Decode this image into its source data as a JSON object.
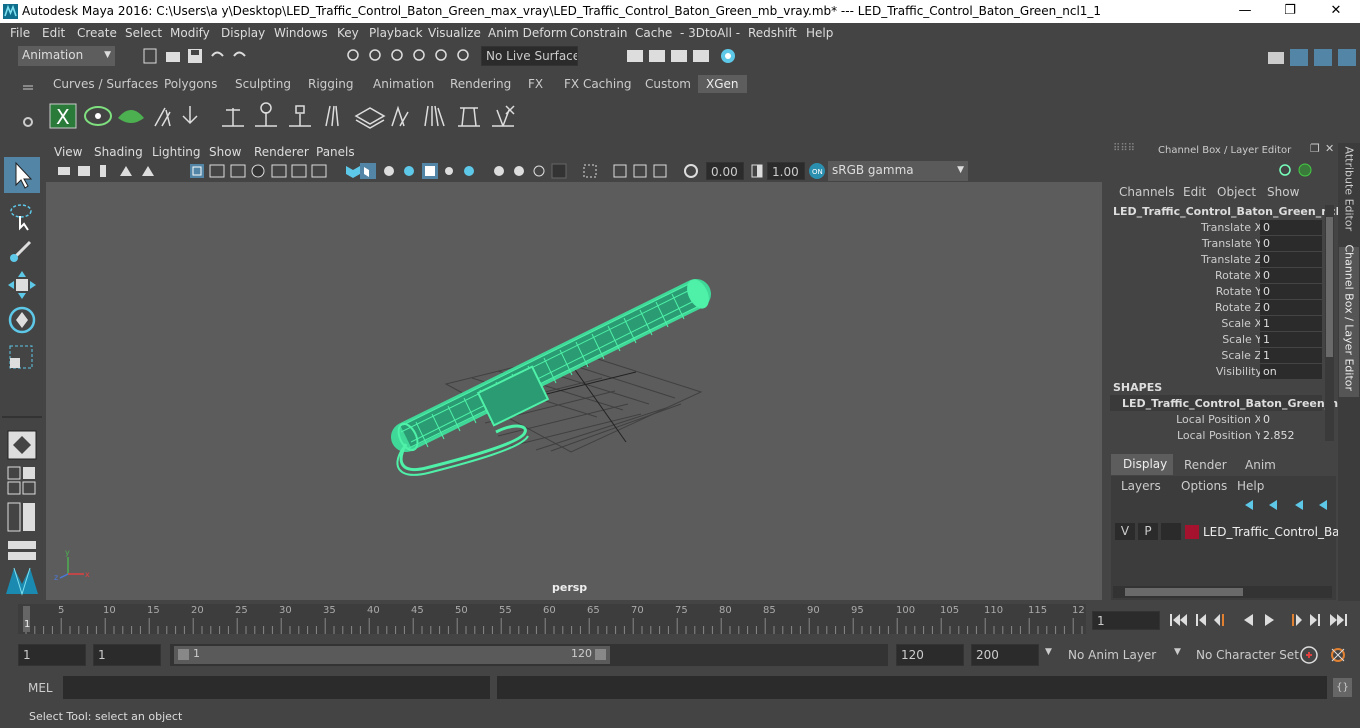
{
  "title": "Autodesk Maya 2016: C:\\Users\\a y\\Desktop\\LED_Traffic_Control_Baton_Green_max_vray\\LED_Traffic_Control_Baton_Green_mb_vray.mb*   ---   LED_Traffic_Control_Baton_Green_ncl1_1",
  "window_controls": {
    "minimize": "—",
    "maximize": "❐",
    "close": "✕"
  },
  "menu": [
    "File",
    "Edit",
    "Create",
    "Select",
    "Modify",
    "Display",
    "Windows",
    "Key",
    "Playback",
    "Visualize",
    "Anim Deform",
    "Constrain",
    "Cache",
    "- 3DtoAll -",
    "Redshift",
    "Help"
  ],
  "status": {
    "mode": "Animation",
    "live_surface": "No Live Surface"
  },
  "shelf_tabs": [
    "Curves / Surfaces",
    "Polygons",
    "Sculpting",
    "Rigging",
    "Animation",
    "Rendering",
    "FX",
    "FX Caching",
    "Custom",
    "XGen"
  ],
  "shelf_active": "XGen",
  "viewport": {
    "menu": [
      "View",
      "Shading",
      "Lighting",
      "Show",
      "Renderer",
      "Panels"
    ],
    "exposure": "0.00",
    "gamma": "1.00",
    "color_space": "sRGB gamma",
    "camera_label": "persp"
  },
  "channel_box": {
    "header": "Channel Box / Layer Editor",
    "menu": [
      "Channels",
      "Edit",
      "Object",
      "Show"
    ],
    "object": "LED_Traffic_Control_Baton_Green_ncl...",
    "channels": [
      {
        "label": "Translate X",
        "value": "0"
      },
      {
        "label": "Translate Y",
        "value": "0"
      },
      {
        "label": "Translate Z",
        "value": "0"
      },
      {
        "label": "Rotate X",
        "value": "0"
      },
      {
        "label": "Rotate Y",
        "value": "0"
      },
      {
        "label": "Rotate Z",
        "value": "0"
      },
      {
        "label": "Scale X",
        "value": "1"
      },
      {
        "label": "Scale Y",
        "value": "1"
      },
      {
        "label": "Scale Z",
        "value": "1"
      },
      {
        "label": "Visibility",
        "value": "on"
      }
    ],
    "shapes_header": "SHAPES",
    "shape_name": "LED_Traffic_Control_Baton_Green_n...",
    "shape_channels": [
      {
        "label": "Local Position X",
        "value": "0"
      },
      {
        "label": "Local Position Y",
        "value": "2.852"
      }
    ],
    "layer_tabs": [
      "Display",
      "Render",
      "Anim"
    ],
    "layer_menu": [
      "Layers",
      "Options",
      "Help"
    ],
    "layer": {
      "v": "V",
      "p": "P",
      "name": "LED_Traffic_Control_Batc",
      "color": "#a5122e"
    }
  },
  "side_tabs": [
    "Attribute Editor",
    "Channel Box / Layer Editor"
  ],
  "timeline": {
    "ticks": [
      "5",
      "10",
      "15",
      "20",
      "25",
      "30",
      "35",
      "40",
      "45",
      "50",
      "55",
      "60",
      "65",
      "70",
      "75",
      "80",
      "85",
      "90",
      "95",
      "100",
      "105",
      "110",
      "115",
      "12"
    ],
    "start_marker": "1",
    "current_frame": "1"
  },
  "range": {
    "start": "1",
    "playback_start": "1",
    "slider_start": "1",
    "slider_end": "120",
    "playback_end": "120",
    "end": "200",
    "anim_layer": "No Anim Layer",
    "character_set": "No Character Set"
  },
  "mel": {
    "label": "MEL"
  },
  "help_line": "Select Tool: select an object",
  "colors": {
    "accent": "#5285a6",
    "baton": "#4ff0a8",
    "layer_color": "#a5122e"
  }
}
